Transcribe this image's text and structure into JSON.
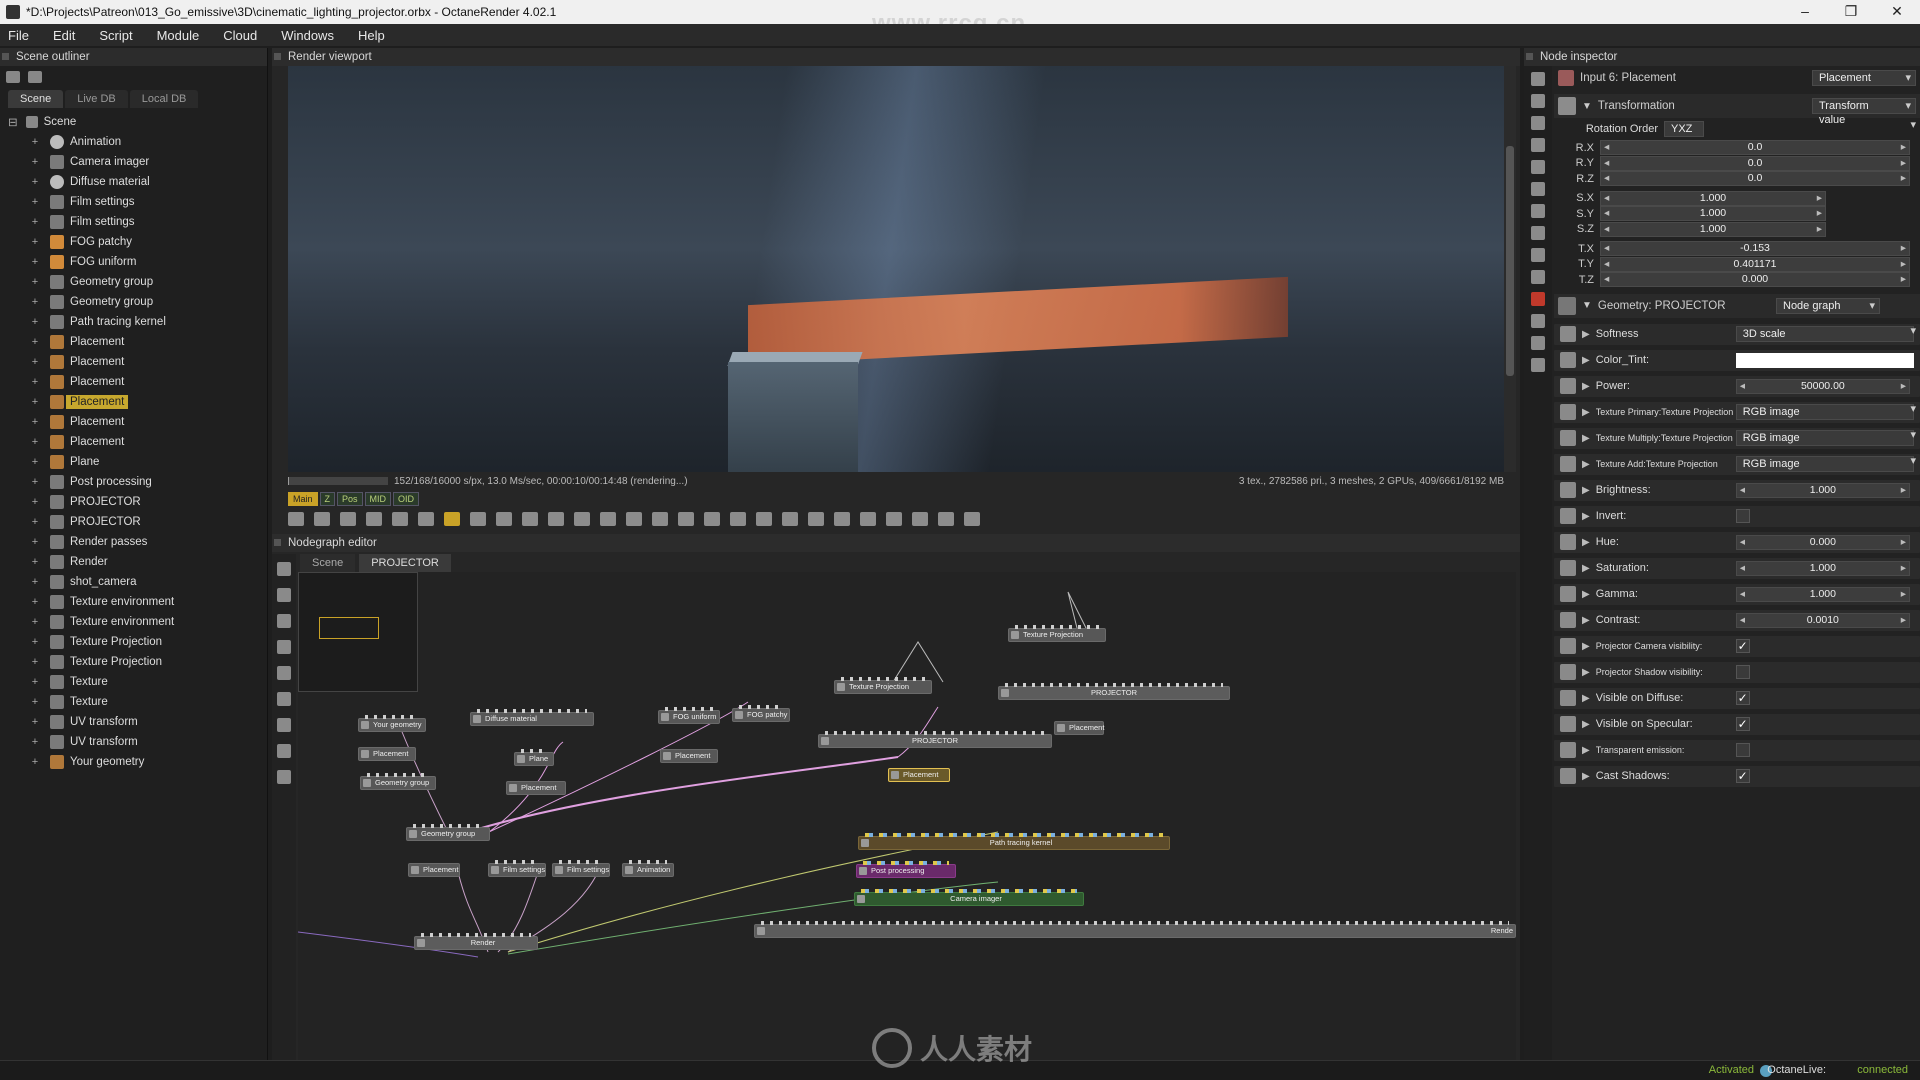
{
  "window": {
    "title": "*D:\\Projects\\Patreon\\013_Go_emissive\\3D\\cinematic_lighting_projector.orbx - OctaneRender 4.02.1",
    "controls": [
      "–",
      "❐",
      "✕"
    ]
  },
  "watermarks": {
    "top": "www.rrcg.cn",
    "bottom": "人人素材"
  },
  "menu": [
    "File",
    "Edit",
    "Script",
    "Module",
    "Cloud",
    "Windows",
    "Help"
  ],
  "scene_outliner": {
    "header": "Scene outliner",
    "tabs": [
      "Scene",
      "Live DB",
      "Local DB"
    ],
    "root": "Scene",
    "items": [
      {
        "label": "Animation",
        "icon": "clock-icon",
        "selected": false
      },
      {
        "label": "Camera imager",
        "icon": "image-icon",
        "selected": false
      },
      {
        "label": "Diffuse material",
        "icon": "sphere-icon",
        "selected": false
      },
      {
        "label": "Film settings",
        "icon": "film-icon",
        "selected": false
      },
      {
        "label": "Film settings",
        "icon": "film-icon",
        "selected": false
      },
      {
        "label": "FOG patchy",
        "icon": "medium-icon",
        "selected": false
      },
      {
        "label": "FOG uniform",
        "icon": "medium-icon",
        "selected": false
      },
      {
        "label": "Geometry group",
        "icon": "group-icon",
        "selected": false
      },
      {
        "label": "Geometry group",
        "icon": "group-icon",
        "selected": false
      },
      {
        "label": "Path tracing kernel",
        "icon": "kernel-icon",
        "selected": false
      },
      {
        "label": "Placement",
        "icon": "placement-icon",
        "selected": false
      },
      {
        "label": "Placement",
        "icon": "placement-icon",
        "selected": false
      },
      {
        "label": "Placement",
        "icon": "placement-icon",
        "selected": false
      },
      {
        "label": "Placement",
        "icon": "placement-icon",
        "selected": true
      },
      {
        "label": "Placement",
        "icon": "placement-icon",
        "selected": false
      },
      {
        "label": "Placement",
        "icon": "placement-icon",
        "selected": false
      },
      {
        "label": "Plane",
        "icon": "mesh-icon",
        "selected": false
      },
      {
        "label": "Post processing",
        "icon": "post-icon",
        "selected": false
      },
      {
        "label": "PROJECTOR",
        "icon": "group-icon",
        "selected": false
      },
      {
        "label": "PROJECTOR",
        "icon": "group-icon",
        "selected": false
      },
      {
        "label": "Render passes",
        "icon": "passes-icon",
        "selected": false
      },
      {
        "label": "Render",
        "icon": "render-icon",
        "selected": false
      },
      {
        "label": "shot_camera",
        "icon": "camera-icon",
        "selected": false
      },
      {
        "label": "Texture environment",
        "icon": "environment-icon",
        "selected": false
      },
      {
        "label": "Texture environment",
        "icon": "environment-icon",
        "selected": false
      },
      {
        "label": "Texture Projection",
        "icon": "projection-icon",
        "selected": false
      },
      {
        "label": "Texture Projection",
        "icon": "projection-icon",
        "selected": false
      },
      {
        "label": "Texture",
        "icon": "texture-icon",
        "selected": false
      },
      {
        "label": "Texture",
        "icon": "texture-icon",
        "selected": false
      },
      {
        "label": "UV transform",
        "icon": "transform-icon",
        "selected": false
      },
      {
        "label": "UV transform",
        "icon": "transform-icon",
        "selected": false
      },
      {
        "label": "Your geometry",
        "icon": "mesh-icon",
        "selected": false
      }
    ]
  },
  "viewport": {
    "header": "Render viewport",
    "status_left": "152/168/16000 s/px, 13.0 Ms/sec, 00:00:10/00:14:48 (rendering...)",
    "status_right": "3 tex., 2782586 pri., 3 meshes, 2 GPUs, 409/6661/8192 MB",
    "progress": 0.01,
    "chips": [
      "Main",
      "Z",
      "Pos",
      "MID",
      "OID"
    ]
  },
  "nodegraph": {
    "header": "Nodegraph editor",
    "tabs": [
      "Scene",
      "PROJECTOR"
    ],
    "nodes": {
      "texture_projection_1": "Texture Projection",
      "texture_projection_2": "Texture Projection",
      "projector_1": "PROJECTOR",
      "projector_2": "PROJECTOR",
      "placement_a": "Placement",
      "placement_b": "Placement",
      "placement_c": "Placement",
      "placement_d": "Placement",
      "placement_e": "Placement",
      "placement_f": "Placement",
      "placement_g": "Placement",
      "your_geometry": "Your geometry",
      "geometry_group_1": "Geometry group",
      "geometry_group_2": "Geometry group",
      "diffuse_material": "Diffuse material",
      "plane": "Plane",
      "fog_uniform": "FOG uniform",
      "fog_patchy": "FOG patchy",
      "film_settings_1": "Film settings",
      "film_settings_2": "Film settings",
      "animation": "Animation",
      "path_tracing_kernel": "Path tracing kernel",
      "post_processing": "Post processing",
      "camera_imager": "Camera imager",
      "render": "Render",
      "render_passes": "Rende"
    }
  },
  "inspector": {
    "header": "Node inspector",
    "input_title": "Input 6: Placement",
    "input_type": "Placement",
    "transformation": {
      "label": "Transformation",
      "mode": "Transform value",
      "rotation_order_label": "Rotation Order",
      "rotation_order": "YXZ",
      "rows": [
        {
          "label": "R.X",
          "value": "0.0"
        },
        {
          "label": "R.Y",
          "value": "0.0"
        },
        {
          "label": "R.Z",
          "value": "0.0"
        },
        {
          "label": "S.X",
          "value": "1.000"
        },
        {
          "label": "S.Y",
          "value": "1.000"
        },
        {
          "label": "S.Z",
          "value": "1.000"
        },
        {
          "label": "T.X",
          "value": "-0.153"
        },
        {
          "label": "T.Y",
          "value": "0.401171"
        },
        {
          "label": "T.Z",
          "value": "0.000"
        }
      ]
    },
    "geometry": {
      "label": "Geometry: PROJECTOR",
      "mode": "Node graph"
    },
    "props": [
      {
        "label": "Softness",
        "kind": "dropdown",
        "value": "3D scale"
      },
      {
        "label": "Color_Tint:",
        "kind": "color",
        "value": "#ffffff"
      },
      {
        "label": "Power:",
        "kind": "slider",
        "value": "50000.00"
      },
      {
        "label": "Texture Primary:Texture Projection",
        "kind": "dropdown",
        "value": "RGB image"
      },
      {
        "label": "Texture Multiply:Texture Projection",
        "kind": "dropdown",
        "value": "RGB image"
      },
      {
        "label": "Texture Add:Texture Projection",
        "kind": "dropdown",
        "value": "RGB image"
      },
      {
        "label": "Brightness:",
        "kind": "slider",
        "value": "1.000"
      },
      {
        "label": "Invert:",
        "kind": "check",
        "value": ""
      },
      {
        "label": "Hue:",
        "kind": "slider",
        "value": "0.000"
      },
      {
        "label": "Saturation:",
        "kind": "slider",
        "value": "1.000"
      },
      {
        "label": "Gamma:",
        "kind": "slider",
        "value": "1.000"
      },
      {
        "label": "Contrast:",
        "kind": "slider",
        "value": "0.0010"
      },
      {
        "label": "Projector Camera visibility:",
        "kind": "check",
        "value": "✓"
      },
      {
        "label": "Projector Shadow visibility:",
        "kind": "check",
        "value": ""
      },
      {
        "label": "Visible on Diffuse:",
        "kind": "check",
        "value": "✓"
      },
      {
        "label": "Visible on Specular:",
        "kind": "check",
        "value": "✓"
      },
      {
        "label": "Transparent emission:",
        "kind": "check",
        "value": ""
      },
      {
        "label": "Cast Shadows:",
        "kind": "check",
        "value": "✓"
      }
    ]
  },
  "statusbar": {
    "activated": "Activated",
    "octanelive": "OctaneLive:",
    "connected": "connected"
  },
  "colors": {
    "accent": "#c9a227",
    "status_ok": "#8ab83a"
  }
}
